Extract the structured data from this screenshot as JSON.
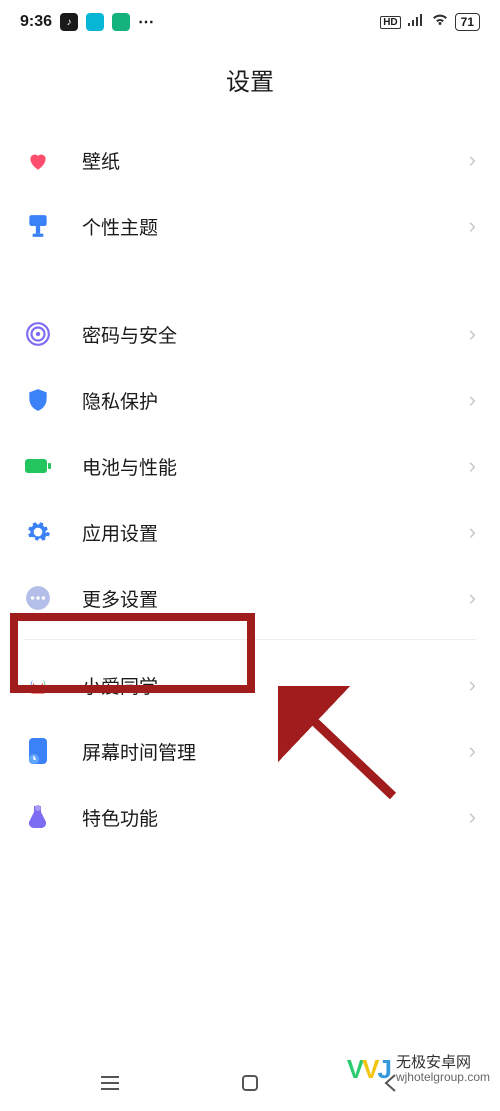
{
  "status_bar": {
    "time": "9:36",
    "hd_label": "HD",
    "battery": "71"
  },
  "header": {
    "title": "设置"
  },
  "groups": [
    {
      "items": [
        {
          "id": "wallpaper",
          "label": "壁纸"
        },
        {
          "id": "themes",
          "label": "个性主题"
        }
      ]
    },
    {
      "items": [
        {
          "id": "password-security",
          "label": "密码与安全"
        },
        {
          "id": "privacy",
          "label": "隐私保护"
        },
        {
          "id": "battery-perf",
          "label": "电池与性能"
        },
        {
          "id": "app-settings",
          "label": "应用设置"
        },
        {
          "id": "more-settings",
          "label": "更多设置"
        }
      ]
    },
    {
      "items": [
        {
          "id": "xiaoai",
          "label": "小爱同学"
        },
        {
          "id": "screen-time",
          "label": "屏幕时间管理"
        },
        {
          "id": "special-features",
          "label": "特色功能"
        }
      ]
    }
  ],
  "watermark": {
    "name": "无极安卓网",
    "url": "wjhotelgroup.com"
  }
}
